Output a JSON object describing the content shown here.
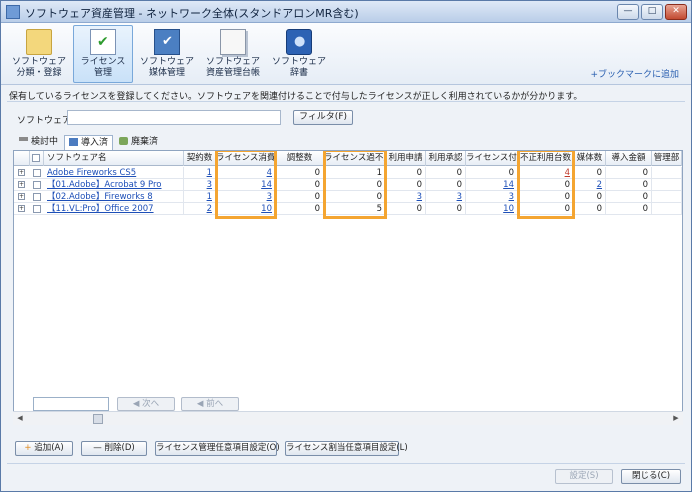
{
  "window": {
    "title": "ソフトウェア資産管理 - ネットワーク全体(スタンドアロンMR含む)",
    "controls": {
      "minimize": "—",
      "maximize": "□",
      "close": "✕"
    }
  },
  "ribbon": {
    "buttons": [
      {
        "label1": "ソフトウェア",
        "label2": "分類・登録",
        "icon": "folder-icon"
      },
      {
        "label1": "ライセンス",
        "label2": "管理",
        "icon": "license-check-icon",
        "active": true
      },
      {
        "label1": "ソフトウェア",
        "label2": "媒体管理",
        "icon": "media-check-icon"
      },
      {
        "label1": "ソフトウェア",
        "label2": "資産管理台帳",
        "icon": "ledger-icon"
      },
      {
        "label1": "ソフトウェア",
        "label2": "辞書",
        "icon": "dictionary-icon"
      }
    ],
    "bookmark": "+ブックマークに追加"
  },
  "info_text": "保有しているライセンスを登録してください。ソフトウェアを関連付けることで付与したライセンスが正しく利用されているかが分かります。",
  "filter": {
    "label": "ソフトウェア名",
    "value": "",
    "button": "フィルタ(F)"
  },
  "tabs": [
    {
      "label": "検討中",
      "icon": "funnel-icon"
    },
    {
      "label": "導入済",
      "icon": "installed-icon",
      "selected": true
    },
    {
      "label": "廃棄済",
      "icon": "trash-icon"
    }
  ],
  "grid": {
    "columns": [
      "ソフトウェア名",
      "契約数",
      "ライセンス消費数",
      "調整数",
      "ライセンス過不足",
      "利用申請",
      "利用承認",
      "ライセンス付与",
      "不正利用台数",
      "媒体数",
      "導入金額",
      "管理部"
    ],
    "highlighted_columns": [
      "ライセンス消費数",
      "ライセンス過不足",
      "不正利用台数"
    ],
    "highlight_color": "#f4a531",
    "rows": [
      {
        "name": "Adobe Fireworks CS5",
        "values": [
          "1",
          "4",
          "0",
          "1",
          "0",
          "0",
          "0",
          "4",
          "0",
          "0",
          ""
        ]
      },
      {
        "name": "【01.Adobe】Acrobat 9 Pro",
        "values": [
          "3",
          "14",
          "0",
          "0",
          "0",
          "0",
          "14",
          "0",
          "2",
          "0",
          ""
        ]
      },
      {
        "name": "【02.Adobe】Fireworks 8",
        "values": [
          "1",
          "3",
          "0",
          "0",
          "3",
          "3",
          "3",
          "0",
          "0",
          "0",
          ""
        ]
      },
      {
        "name": "【11.VL:Pro】Office 2007",
        "values": [
          "2",
          "10",
          "0",
          "5",
          "0",
          "0",
          "10",
          "0",
          "0",
          "0",
          ""
        ]
      }
    ],
    "linked_cells": [
      [
        true,
        true,
        false,
        false,
        false,
        false,
        false,
        true,
        false,
        false,
        false
      ],
      [
        true,
        true,
        false,
        false,
        false,
        false,
        true,
        false,
        true,
        false,
        false
      ],
      [
        true,
        true,
        false,
        false,
        true,
        true,
        true,
        false,
        false,
        false,
        false
      ],
      [
        true,
        true,
        false,
        false,
        false,
        false,
        true,
        false,
        false,
        false,
        false
      ]
    ]
  },
  "pager": {
    "next": "次へ",
    "prev": "前へ"
  },
  "bottom_buttons": {
    "add": "追加(A)",
    "delete": "削除(D)",
    "license_settings": "ライセンス管理任意項目設定(O)",
    "assign_settings": "ライセンス割当任意項目設定(L)",
    "apply": "設定(S)",
    "close": "閉じる(C)"
  }
}
